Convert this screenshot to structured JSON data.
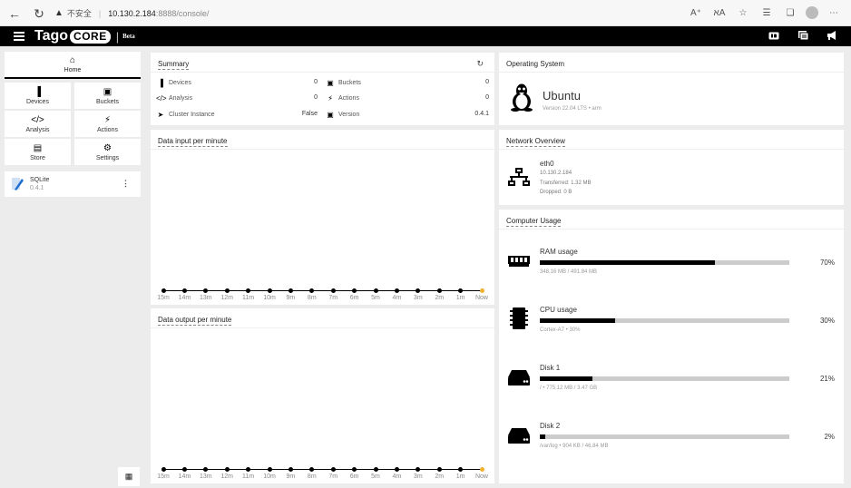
{
  "browser": {
    "security_label": "不安全",
    "url_host": "10.130.2.184",
    "url_path": ":8888/console/"
  },
  "header": {
    "logo_text": "Tago",
    "logo_core": "CORE",
    "beta": "Beta"
  },
  "sidebar": {
    "home_label": "Home",
    "tiles": [
      "Devices",
      "Buckets",
      "Analysis",
      "Actions",
      "Store",
      "Settings"
    ],
    "database": {
      "name": "SQLite",
      "version": "0.4.1"
    }
  },
  "summary": {
    "title": "Summary",
    "rows": [
      {
        "label": "Devices",
        "value": "0"
      },
      {
        "label": "Analysis",
        "value": "0"
      },
      {
        "label": "Cluster Instance",
        "value": "False"
      },
      {
        "label": "Buckets",
        "value": "0"
      },
      {
        "label": "Actions",
        "value": "0"
      },
      {
        "label": "Version",
        "value": "0.4.1"
      }
    ]
  },
  "charts": {
    "input_title": "Data input per minute",
    "output_title": "Data output per minute",
    "ticks": [
      "15m",
      "14m",
      "13m",
      "12m",
      "11m",
      "10m",
      "9m",
      "8m",
      "7m",
      "6m",
      "5m",
      "4m",
      "3m",
      "2m",
      "1m",
      "Now"
    ]
  },
  "os": {
    "title": "Operating System",
    "name": "Ubuntu",
    "version": "Version 22.04 LTS • arm"
  },
  "network": {
    "title": "Network Overview",
    "iface": "eth0",
    "ip": "10.130.2.184",
    "transferred": "Transferred: 1.32 MB",
    "dropped": "Dropped: 0 B"
  },
  "usage": {
    "title": "Computer Usage",
    "items": [
      {
        "label": "RAM usage",
        "percent": 70,
        "percent_text": "70%",
        "detail": "348.16 MB / 491.84 MB"
      },
      {
        "label": "CPU usage",
        "percent": 30,
        "percent_text": "30%",
        "detail": "Cortex-A7 • 30%"
      },
      {
        "label": "Disk 1",
        "percent": 21,
        "percent_text": "21%",
        "detail": "/ • 775.12 MB / 3.47 GB"
      },
      {
        "label": "Disk 2",
        "percent": 2,
        "percent_text": "2%",
        "detail": "/var/log • 904 KB / 46.84 MB"
      }
    ]
  }
}
